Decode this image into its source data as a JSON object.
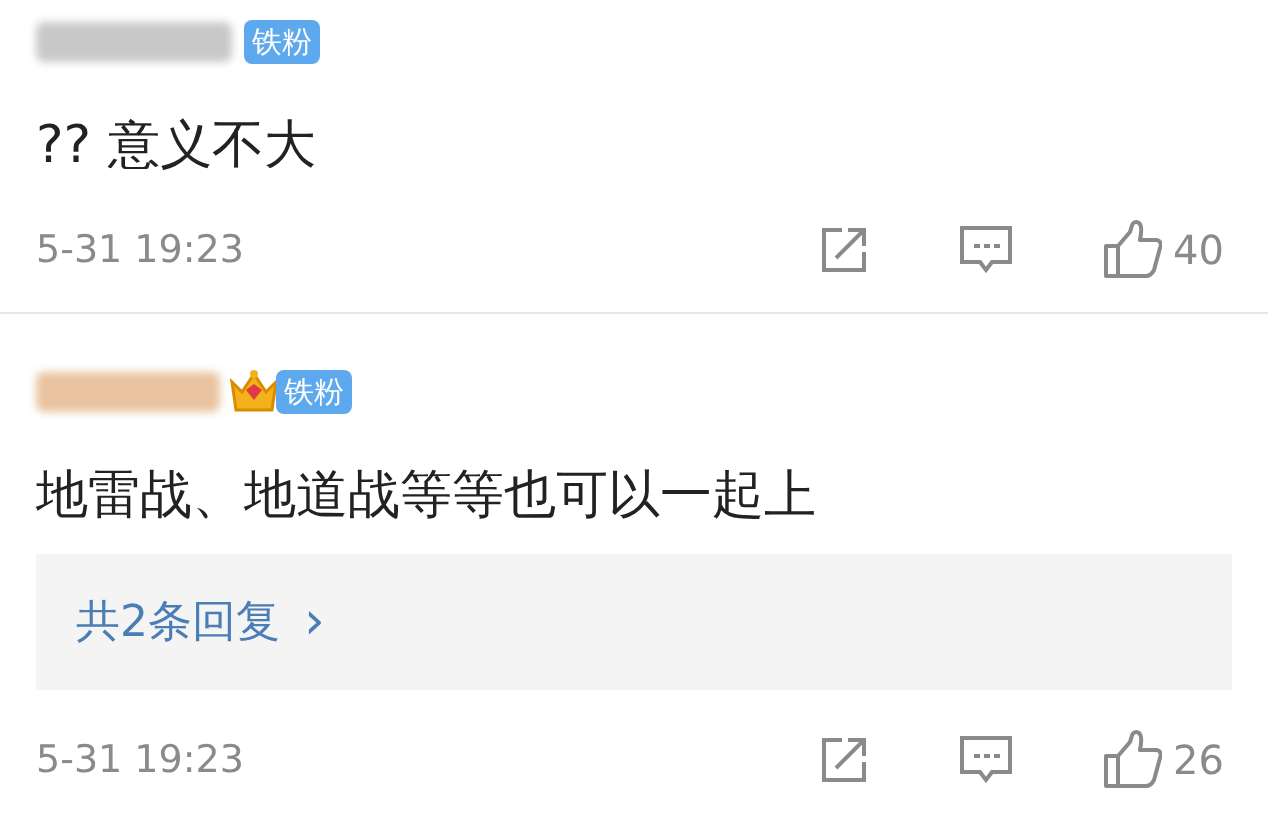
{
  "comments": [
    {
      "vip": false,
      "badge": "铁粉",
      "text": "?? 意义不大",
      "time": "5-31 19:23",
      "likes": "40"
    },
    {
      "vip": true,
      "badge": "铁粉",
      "text": "地雷战、地道战等等也可以一起上",
      "replies": "共2条回复",
      "reply_arrow": "›",
      "time": "5-31 19:23",
      "likes": "26"
    }
  ]
}
